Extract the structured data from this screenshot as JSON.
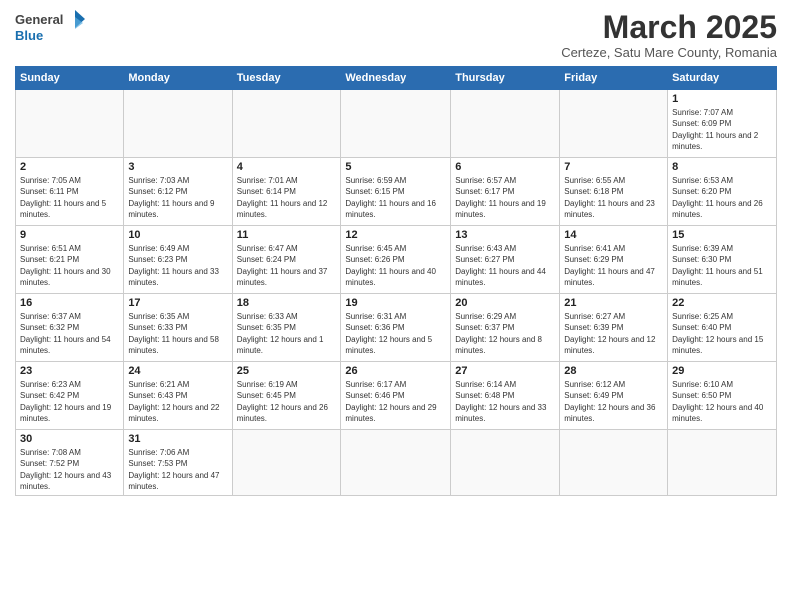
{
  "header": {
    "logo_general": "General",
    "logo_blue": "Blue",
    "main_title": "March 2025",
    "subtitle": "Certeze, Satu Mare County, Romania"
  },
  "days_of_week": [
    "Sunday",
    "Monday",
    "Tuesday",
    "Wednesday",
    "Thursday",
    "Friday",
    "Saturday"
  ],
  "weeks": [
    {
      "days": [
        {
          "num": "",
          "info": ""
        },
        {
          "num": "",
          "info": ""
        },
        {
          "num": "",
          "info": ""
        },
        {
          "num": "",
          "info": ""
        },
        {
          "num": "",
          "info": ""
        },
        {
          "num": "",
          "info": ""
        },
        {
          "num": "1",
          "info": "Sunrise: 7:07 AM\nSunset: 6:09 PM\nDaylight: 11 hours and 2 minutes."
        }
      ]
    },
    {
      "days": [
        {
          "num": "2",
          "info": "Sunrise: 7:05 AM\nSunset: 6:11 PM\nDaylight: 11 hours and 5 minutes."
        },
        {
          "num": "3",
          "info": "Sunrise: 7:03 AM\nSunset: 6:12 PM\nDaylight: 11 hours and 9 minutes."
        },
        {
          "num": "4",
          "info": "Sunrise: 7:01 AM\nSunset: 6:14 PM\nDaylight: 11 hours and 12 minutes."
        },
        {
          "num": "5",
          "info": "Sunrise: 6:59 AM\nSunset: 6:15 PM\nDaylight: 11 hours and 16 minutes."
        },
        {
          "num": "6",
          "info": "Sunrise: 6:57 AM\nSunset: 6:17 PM\nDaylight: 11 hours and 19 minutes."
        },
        {
          "num": "7",
          "info": "Sunrise: 6:55 AM\nSunset: 6:18 PM\nDaylight: 11 hours and 23 minutes."
        },
        {
          "num": "8",
          "info": "Sunrise: 6:53 AM\nSunset: 6:20 PM\nDaylight: 11 hours and 26 minutes."
        }
      ]
    },
    {
      "days": [
        {
          "num": "9",
          "info": "Sunrise: 6:51 AM\nSunset: 6:21 PM\nDaylight: 11 hours and 30 minutes."
        },
        {
          "num": "10",
          "info": "Sunrise: 6:49 AM\nSunset: 6:23 PM\nDaylight: 11 hours and 33 minutes."
        },
        {
          "num": "11",
          "info": "Sunrise: 6:47 AM\nSunset: 6:24 PM\nDaylight: 11 hours and 37 minutes."
        },
        {
          "num": "12",
          "info": "Sunrise: 6:45 AM\nSunset: 6:26 PM\nDaylight: 11 hours and 40 minutes."
        },
        {
          "num": "13",
          "info": "Sunrise: 6:43 AM\nSunset: 6:27 PM\nDaylight: 11 hours and 44 minutes."
        },
        {
          "num": "14",
          "info": "Sunrise: 6:41 AM\nSunset: 6:29 PM\nDaylight: 11 hours and 47 minutes."
        },
        {
          "num": "15",
          "info": "Sunrise: 6:39 AM\nSunset: 6:30 PM\nDaylight: 11 hours and 51 minutes."
        }
      ]
    },
    {
      "days": [
        {
          "num": "16",
          "info": "Sunrise: 6:37 AM\nSunset: 6:32 PM\nDaylight: 11 hours and 54 minutes."
        },
        {
          "num": "17",
          "info": "Sunrise: 6:35 AM\nSunset: 6:33 PM\nDaylight: 11 hours and 58 minutes."
        },
        {
          "num": "18",
          "info": "Sunrise: 6:33 AM\nSunset: 6:35 PM\nDaylight: 12 hours and 1 minute."
        },
        {
          "num": "19",
          "info": "Sunrise: 6:31 AM\nSunset: 6:36 PM\nDaylight: 12 hours and 5 minutes."
        },
        {
          "num": "20",
          "info": "Sunrise: 6:29 AM\nSunset: 6:37 PM\nDaylight: 12 hours and 8 minutes."
        },
        {
          "num": "21",
          "info": "Sunrise: 6:27 AM\nSunset: 6:39 PM\nDaylight: 12 hours and 12 minutes."
        },
        {
          "num": "22",
          "info": "Sunrise: 6:25 AM\nSunset: 6:40 PM\nDaylight: 12 hours and 15 minutes."
        }
      ]
    },
    {
      "days": [
        {
          "num": "23",
          "info": "Sunrise: 6:23 AM\nSunset: 6:42 PM\nDaylight: 12 hours and 19 minutes."
        },
        {
          "num": "24",
          "info": "Sunrise: 6:21 AM\nSunset: 6:43 PM\nDaylight: 12 hours and 22 minutes."
        },
        {
          "num": "25",
          "info": "Sunrise: 6:19 AM\nSunset: 6:45 PM\nDaylight: 12 hours and 26 minutes."
        },
        {
          "num": "26",
          "info": "Sunrise: 6:17 AM\nSunset: 6:46 PM\nDaylight: 12 hours and 29 minutes."
        },
        {
          "num": "27",
          "info": "Sunrise: 6:14 AM\nSunset: 6:48 PM\nDaylight: 12 hours and 33 minutes."
        },
        {
          "num": "28",
          "info": "Sunrise: 6:12 AM\nSunset: 6:49 PM\nDaylight: 12 hours and 36 minutes."
        },
        {
          "num": "29",
          "info": "Sunrise: 6:10 AM\nSunset: 6:50 PM\nDaylight: 12 hours and 40 minutes."
        }
      ]
    },
    {
      "days": [
        {
          "num": "30",
          "info": "Sunrise: 7:08 AM\nSunset: 7:52 PM\nDaylight: 12 hours and 43 minutes."
        },
        {
          "num": "31",
          "info": "Sunrise: 7:06 AM\nSunset: 7:53 PM\nDaylight: 12 hours and 47 minutes."
        },
        {
          "num": "",
          "info": ""
        },
        {
          "num": "",
          "info": ""
        },
        {
          "num": "",
          "info": ""
        },
        {
          "num": "",
          "info": ""
        },
        {
          "num": "",
          "info": ""
        }
      ]
    }
  ]
}
